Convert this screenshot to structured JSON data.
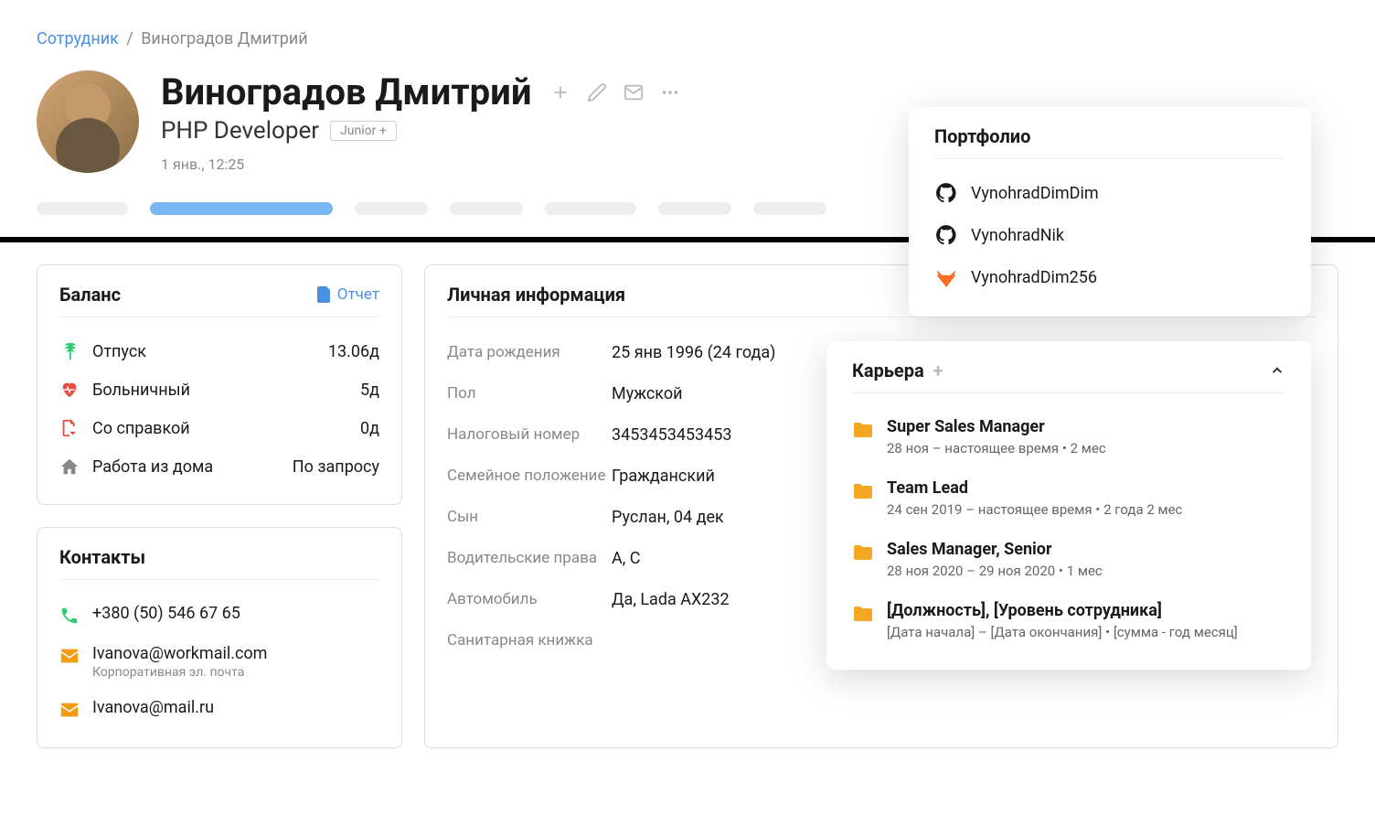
{
  "breadcrumb": {
    "link": "Сотрудник",
    "current": "Виноградов Дмитрий"
  },
  "profile": {
    "name": "Виноградов Дмитрий",
    "role": "PHP Developer",
    "badge": "Junior +",
    "timestamp": "1 янв., 12:25"
  },
  "balance": {
    "title": "Баланс",
    "report": "Отчет",
    "items": [
      {
        "label": "Отпуск",
        "value": "13.06д"
      },
      {
        "label": "Больничный",
        "value": "5д"
      },
      {
        "label": "Со справкой",
        "value": "0д"
      },
      {
        "label": "Работа из дома",
        "value": "По запросу"
      }
    ]
  },
  "contacts": {
    "title": "Контакты",
    "items": [
      {
        "value": "+380 (50) 546 67 65",
        "sub": ""
      },
      {
        "value": "Ivanova@workmail.com",
        "sub": "Корпоративная эл. почта"
      },
      {
        "value": "Ivanova@mail.ru",
        "sub": ""
      }
    ]
  },
  "info": {
    "title": "Личная информация",
    "rows": [
      {
        "label": "Дата рождения",
        "value": "25 янв 1996  (24 года)"
      },
      {
        "label": "Пол",
        "value": "Мужской"
      },
      {
        "label": "Налоговый номер",
        "value": "3453453453453"
      },
      {
        "label": "Семейное положение",
        "value": "Гражданский"
      },
      {
        "label": "Сын",
        "value": "Руслан, 04 дек"
      },
      {
        "label": "Водительские права",
        "value": "A, C"
      },
      {
        "label": "Автомобиль",
        "value": "Да, Lada AX232"
      },
      {
        "label": "Санитарная книжка",
        "value": ""
      }
    ]
  },
  "portfolio": {
    "title": "Портфолио",
    "items": [
      {
        "name": "VynohradDimDim",
        "type": "github"
      },
      {
        "name": "VynohradNik",
        "type": "github"
      },
      {
        "name": "VynohradDim256",
        "type": "gitlab"
      }
    ]
  },
  "career": {
    "title": "Карьера",
    "items": [
      {
        "title": "Super Sales Manager",
        "sub": "28 ноя – настоящее время • 2 мес"
      },
      {
        "title": "Team Lead",
        "sub": "24 сен 2019 – настоящее время • 2 года 2 мес"
      },
      {
        "title": "Sales Manager, Senior",
        "sub": "28 ноя 2020 – 29 ноя 2020 • 1 мес"
      },
      {
        "title": "[Должность], [Уровень сотрудника]",
        "sub": "[Дата начала] – [Дата окончания] • [сумма - год месяц]"
      }
    ]
  }
}
